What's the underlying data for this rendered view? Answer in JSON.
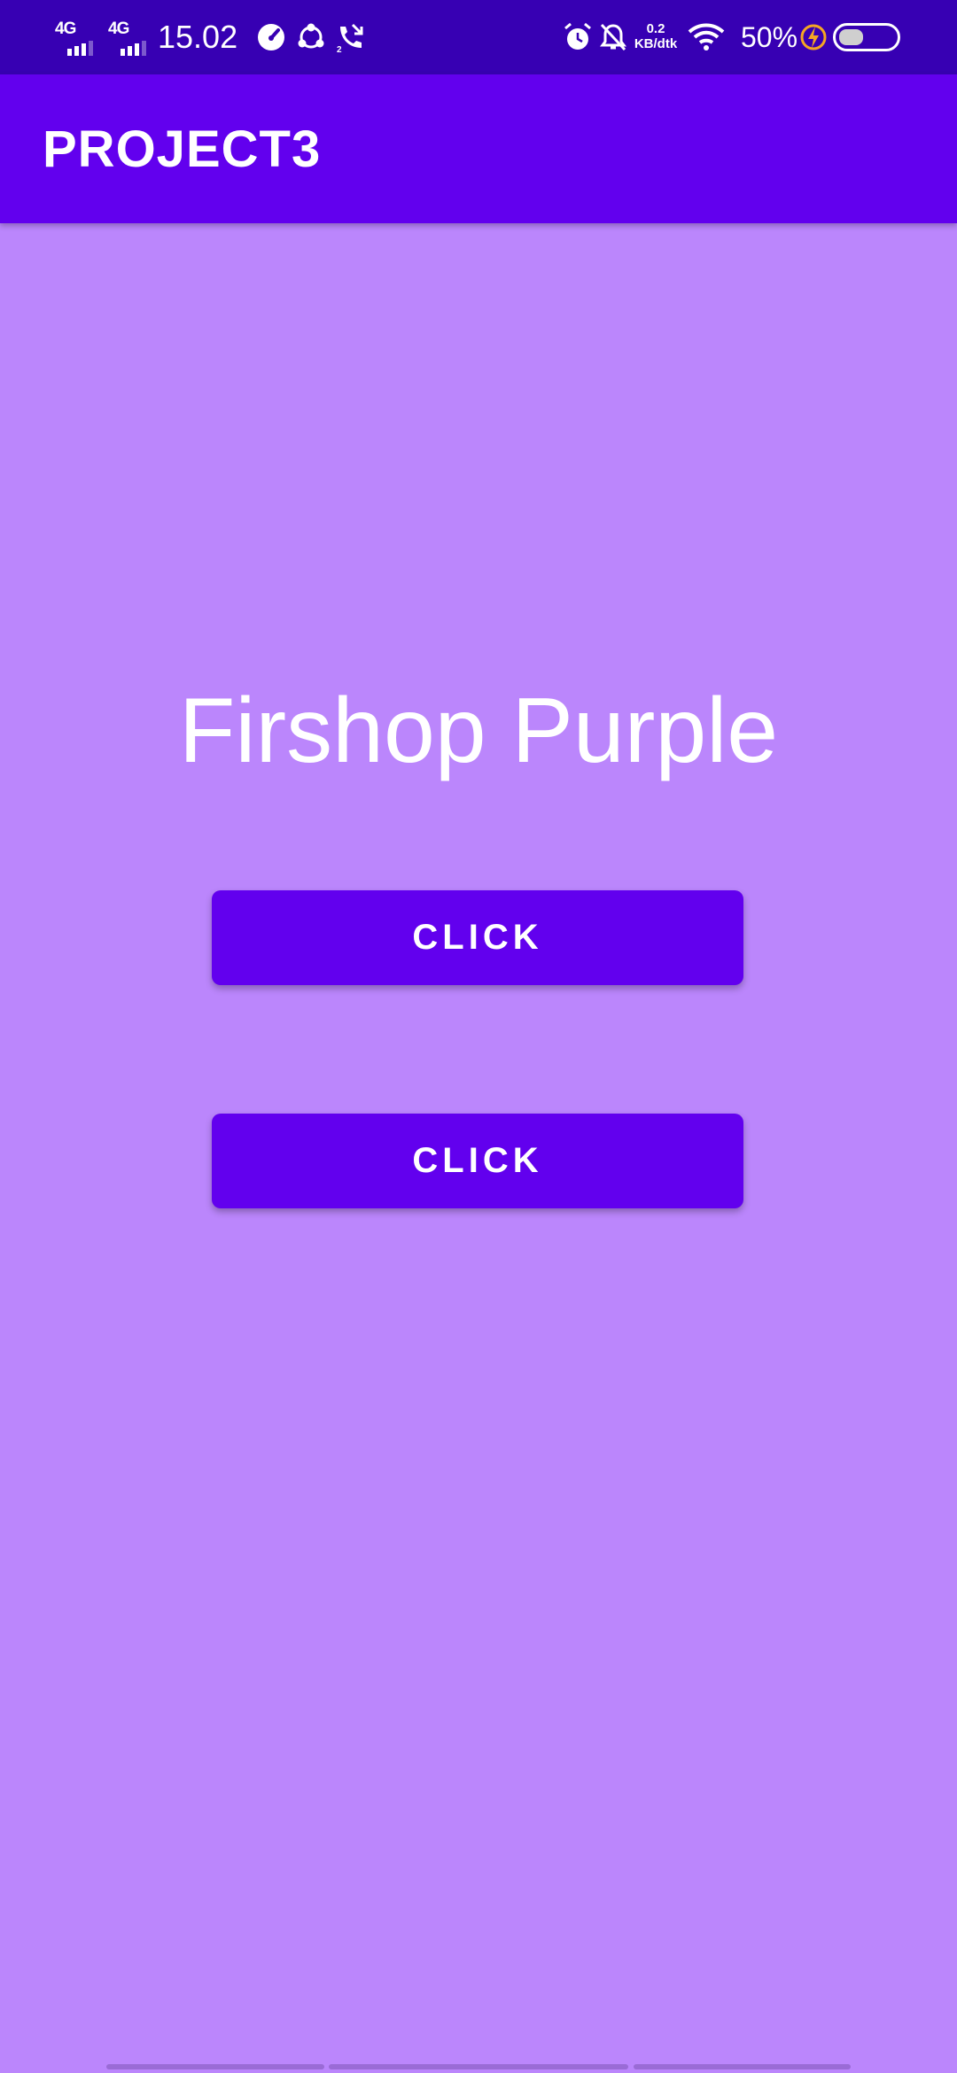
{
  "status_bar": {
    "network_1": "4G",
    "network_2": "4G",
    "time": "15.02",
    "data_speed_value": "0.2",
    "data_speed_unit": "KB/dtk",
    "battery_percent": "50%",
    "battery_level": 0.5,
    "icons": [
      "speedometer-icon",
      "share-icon",
      "missed-call-icon",
      "alarm-icon",
      "bell-off-icon",
      "wifi-icon",
      "charging-icon"
    ]
  },
  "app_bar": {
    "title": "PROJECT3"
  },
  "main": {
    "headline": "Firshop Purple",
    "button_1_label": "CLICK",
    "button_2_label": "CLICK"
  },
  "colors": {
    "status_bar": "#3700b3",
    "app_bar": "#6200ee",
    "background": "#bb86fc",
    "button": "#6200ee",
    "text": "#ffffff",
    "charging_bolt": "#f5a623"
  }
}
